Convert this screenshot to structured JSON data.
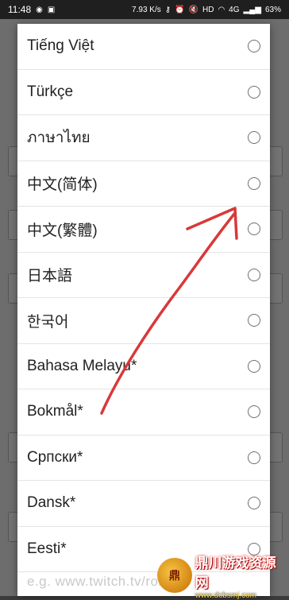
{
  "status_bar": {
    "time": "11:48",
    "speed": "7.93 K/s",
    "hd": "HD",
    "network": "4G",
    "battery": "63%"
  },
  "background": {
    "watermark_url_fragment": "e.g. www.twitch.tv/rob"
  },
  "language_dialog": {
    "items": [
      {
        "label": "Tiếng Việt"
      },
      {
        "label": "Türkçe"
      },
      {
        "label": "ภาษาไทย"
      },
      {
        "label": "中文(简体)"
      },
      {
        "label": "中文(繁體)"
      },
      {
        "label": "日本語"
      },
      {
        "label": "한국어"
      },
      {
        "label": "Bahasa Melayu*"
      },
      {
        "label": "Bokmål*"
      },
      {
        "label": "Српски*"
      },
      {
        "label": "Dansk*"
      },
      {
        "label": "Eesti*"
      }
    ]
  },
  "watermark": {
    "logo_text": "鼎",
    "title": "鼎川游戏资源网",
    "url": "www.dcbsmj.com"
  },
  "colors": {
    "arrow": "#d9383a",
    "dialog_bg": "#ffffff",
    "radio_border": "#6f6f6f"
  }
}
